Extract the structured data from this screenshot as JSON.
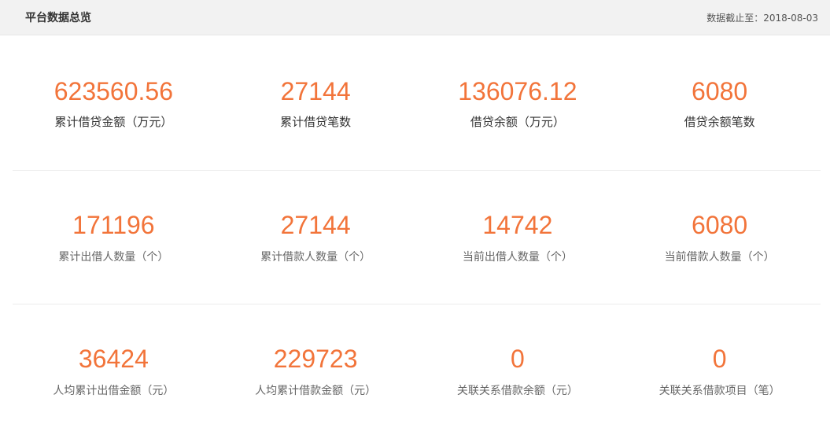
{
  "header": {
    "title": "平台数据总览",
    "date_text": "数据截止至：2018-08-03"
  },
  "rows": [
    [
      {
        "value": "623560.56",
        "label": "累计借贷金额（万元）"
      },
      {
        "value": "27144",
        "label": "累计借贷笔数"
      },
      {
        "value": "136076.12",
        "label": "借贷余额（万元）"
      },
      {
        "value": "6080",
        "label": "借贷余额笔数"
      }
    ],
    [
      {
        "value": "171196",
        "label": "累计出借人数量（个）"
      },
      {
        "value": "27144",
        "label": "累计借款人数量（个）"
      },
      {
        "value": "14742",
        "label": "当前出借人数量（个）"
      },
      {
        "value": "6080",
        "label": "当前借款人数量（个）"
      }
    ],
    [
      {
        "value": "36424",
        "label": "人均累计出借金额（元）"
      },
      {
        "value": "229723",
        "label": "人均累计借款金额（元）"
      },
      {
        "value": "0",
        "label": "关联关系借款余额（元）"
      },
      {
        "value": "0",
        "label": "关联关系借款项目（笔）"
      }
    ]
  ],
  "colors": {
    "accent": "#f2743a",
    "header_bg": "#f2f2f2"
  }
}
